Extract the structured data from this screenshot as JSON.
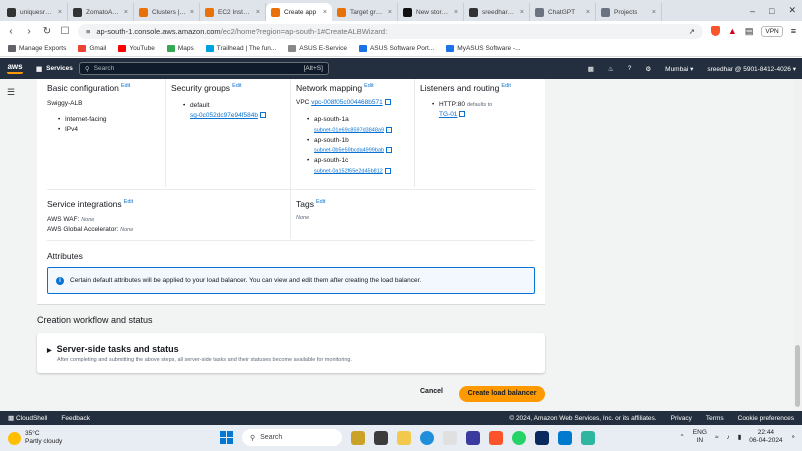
{
  "browser": {
    "tabs": [
      {
        "label": "uniquesreedha",
        "color": "#333333",
        "icon": "github-icon"
      },
      {
        "label": "ZomatoApp-C",
        "color": "#333333",
        "icon": "github-icon"
      },
      {
        "label": "Clusters | Elasti",
        "color": "#e8710a",
        "icon": "aws-icon"
      },
      {
        "label": "EC2 Instance C",
        "color": "#e8710a",
        "icon": "aws-icon"
      },
      {
        "label": "Create app",
        "color": "#e8710a",
        "icon": "aws-icon",
        "active": true
      },
      {
        "label": "Target group d",
        "color": "#e8710a",
        "icon": "aws-icon"
      },
      {
        "label": "New story – Me",
        "color": "#111111",
        "icon": "medium-icon"
      },
      {
        "label": "sreedhar8897/",
        "color": "#333333",
        "icon": "github-icon"
      },
      {
        "label": "ChatGPT",
        "color": "#6b7280",
        "icon": "chatgpt-icon"
      },
      {
        "label": "Projects",
        "color": "#6b7280",
        "icon": "projects-icon"
      }
    ],
    "url_main": "ap-south-1.console.aws.amazon.com",
    "url_rest": "/ec2/home?region=ap-south-1#CreateALBWizard:",
    "vpn": "VPN",
    "bookmarks": [
      {
        "label": "Manage Exports",
        "color": "#5f6368"
      },
      {
        "label": "Gmail",
        "color": "#ea4335"
      },
      {
        "label": "YouTube",
        "color": "#ff0000"
      },
      {
        "label": "Maps",
        "color": "#34a853"
      },
      {
        "label": "Trailhead | The fun...",
        "color": "#00a1e0"
      },
      {
        "label": "ASUS E-Service",
        "color": "#888888"
      },
      {
        "label": "ASUS Software Port...",
        "color": "#1a73e8"
      },
      {
        "label": "MyASUS Software -...",
        "color": "#1a73e8"
      }
    ]
  },
  "aws": {
    "logo": "aws",
    "services": "Services",
    "search_placeholder": "Search",
    "search_shortcut": "[Alt+S]",
    "region": "Mumbai ▾",
    "account": "sreedhar @ 5901-8412-4026 ▾"
  },
  "review": {
    "basic": {
      "title": "Basic configuration",
      "edit": "Edit",
      "name": "Swiggy-ALB",
      "items": [
        "Internet-facing",
        "IPv4"
      ]
    },
    "security": {
      "title": "Security groups",
      "edit": "Edit",
      "item": "default",
      "sg": "sg-0c052dc97e94f584b"
    },
    "network": {
      "title": "Network mapping",
      "edit": "Edit",
      "vpc_label": "VPC",
      "vpc": "vpc-008f05c004468b571",
      "azs": [
        {
          "az": "ap-south-1a",
          "subnet": "subnet-01e69c8597d3848a9"
        },
        {
          "az": "ap-south-1b",
          "subnet": "subnet-0b5e59bcda4999bab"
        },
        {
          "az": "ap-south-1c",
          "subnet": "subnet-0a152f65e2d45b812"
        }
      ]
    },
    "listeners": {
      "title": "Listeners and routing",
      "edit": "Edit",
      "listener": "HTTP:80",
      "defaults_to": "defaults to",
      "target": "TG-01"
    },
    "integrations": {
      "title": "Service integrations",
      "edit": "Edit",
      "waf_label": "AWS WAF:",
      "waf_value": "None",
      "ga_label": "AWS Global Accelerator:",
      "ga_value": "None"
    },
    "tags": {
      "title": "Tags",
      "edit": "Edit",
      "value": "None"
    },
    "attributes": {
      "title": "Attributes",
      "info": "Certain default attributes will be applied to your load balancer. You can view and edit them after creating the load balancer."
    }
  },
  "workflow": {
    "title": "Creation workflow and status",
    "subtitle": "Server-side tasks and status",
    "description": "After completing and submitting the above steps, all server-side tasks and their statuses become available for monitoring."
  },
  "actions": {
    "cancel": "Cancel",
    "create": "Create load balancer"
  },
  "footer": {
    "cloudshell": "CloudShell",
    "feedback": "Feedback",
    "copyright": "© 2024, Amazon Web Services, Inc. or its affiliates.",
    "privacy": "Privacy",
    "terms": "Terms",
    "cookies": "Cookie preferences"
  },
  "taskbar": {
    "temp": "35°C",
    "weather": "Partly cloudy",
    "search": "Search",
    "lang1": "ENG",
    "lang2": "IN",
    "time": "22:44",
    "date": "06-04-2024"
  }
}
